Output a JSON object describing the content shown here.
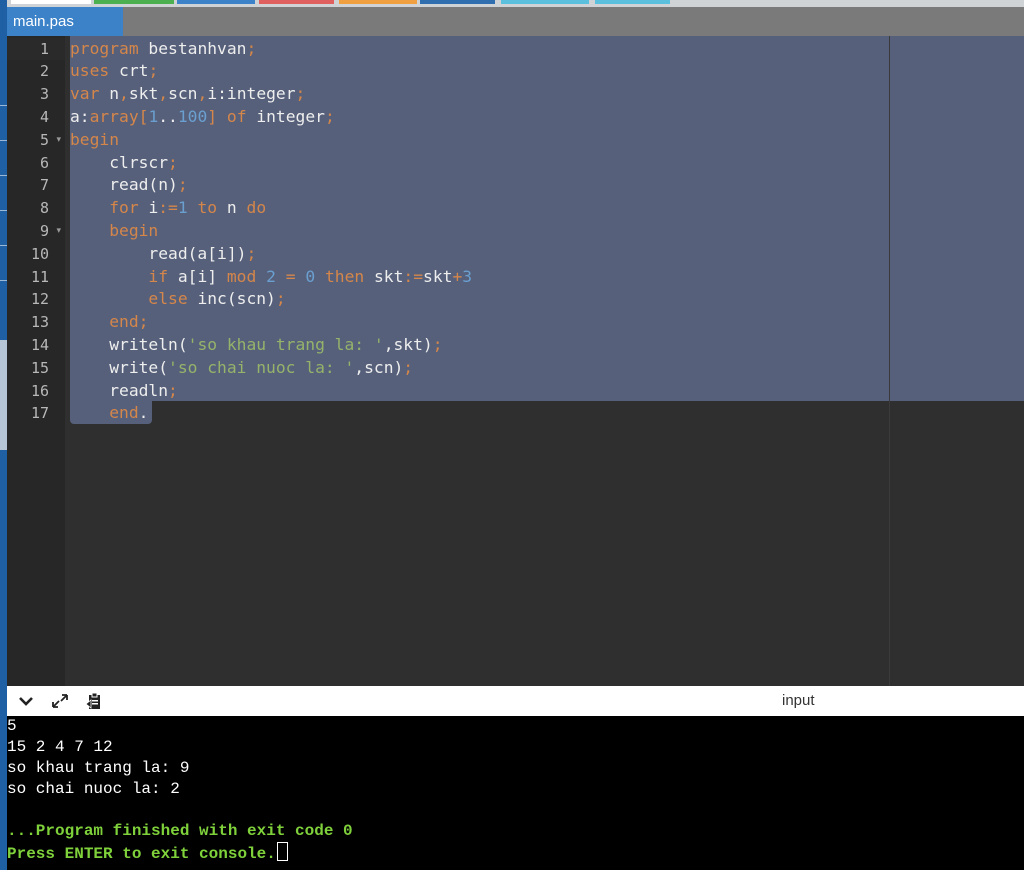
{
  "colors": {
    "tab_active": "#3c82c8",
    "keyword": "#d5864a",
    "number": "#6a9fd0",
    "string": "#95b36a",
    "selection": "#56607a",
    "console_green": "#7fd13b"
  },
  "tab": {
    "label": "main.pas"
  },
  "editor": {
    "line_numbers": [
      "1",
      "2",
      "3",
      "4",
      "5",
      "6",
      "7",
      "8",
      "9",
      "10",
      "11",
      "12",
      "13",
      "14",
      "15",
      "16",
      "17"
    ],
    "lines": [
      [
        [
          "kw",
          "program"
        ],
        [
          "pl",
          " bestanhvan"
        ],
        [
          "op",
          ";"
        ]
      ],
      [
        [
          "kw",
          "uses"
        ],
        [
          "pl",
          " crt"
        ],
        [
          "op",
          ";"
        ]
      ],
      [
        [
          "kw",
          "var"
        ],
        [
          "pl",
          " n"
        ],
        [
          "op",
          ","
        ],
        [
          "pl",
          "skt"
        ],
        [
          "op",
          ","
        ],
        [
          "pl",
          "scn"
        ],
        [
          "op",
          ","
        ],
        [
          "pl",
          "i:integer"
        ],
        [
          "op",
          ";"
        ]
      ],
      [
        [
          "pl",
          "a:"
        ],
        [
          "kw",
          "array"
        ],
        [
          "op",
          "["
        ],
        [
          "num",
          "1"
        ],
        [
          "pl",
          ".."
        ],
        [
          "num",
          "100"
        ],
        [
          "op",
          "]"
        ],
        [
          "pl",
          " "
        ],
        [
          "kw",
          "of"
        ],
        [
          "pl",
          " integer"
        ],
        [
          "op",
          ";"
        ]
      ],
      [
        [
          "kw",
          "begin"
        ]
      ],
      [
        [
          "pl",
          "    clrscr"
        ],
        [
          "op",
          ";"
        ]
      ],
      [
        [
          "pl",
          "    read(n)"
        ],
        [
          "op",
          ";"
        ]
      ],
      [
        [
          "pl",
          "    "
        ],
        [
          "kw",
          "for"
        ],
        [
          "pl",
          " i"
        ],
        [
          "op",
          ":="
        ],
        [
          "num",
          "1"
        ],
        [
          "pl",
          " "
        ],
        [
          "kw",
          "to"
        ],
        [
          "pl",
          " n "
        ],
        [
          "kw",
          "do"
        ]
      ],
      [
        [
          "pl",
          "    "
        ],
        [
          "kw",
          "begin"
        ]
      ],
      [
        [
          "pl",
          "        read(a[i])"
        ],
        [
          "op",
          ";"
        ]
      ],
      [
        [
          "pl",
          "        "
        ],
        [
          "kw",
          "if"
        ],
        [
          "pl",
          " a[i] "
        ],
        [
          "kw",
          "mod"
        ],
        [
          "pl",
          " "
        ],
        [
          "num",
          "2"
        ],
        [
          "pl",
          " "
        ],
        [
          "op",
          "="
        ],
        [
          "pl",
          " "
        ],
        [
          "num",
          "0"
        ],
        [
          "pl",
          " "
        ],
        [
          "kw",
          "then"
        ],
        [
          "pl",
          " skt"
        ],
        [
          "op",
          ":="
        ],
        [
          "pl",
          "skt"
        ],
        [
          "op",
          "+"
        ],
        [
          "num",
          "3"
        ]
      ],
      [
        [
          "pl",
          "        "
        ],
        [
          "kw",
          "else"
        ],
        [
          "pl",
          " inc(scn)"
        ],
        [
          "op",
          ";"
        ]
      ],
      [
        [
          "pl",
          "    "
        ],
        [
          "kw",
          "end"
        ],
        [
          "op",
          ";"
        ]
      ],
      [
        [
          "pl",
          "    writeln("
        ],
        [
          "str",
          "'so khau trang la: '"
        ],
        [
          "pl",
          ",skt)"
        ],
        [
          "op",
          ";"
        ]
      ],
      [
        [
          "pl",
          "    write("
        ],
        [
          "str",
          "'so chai nuoc la: '"
        ],
        [
          "pl",
          ",scn)"
        ],
        [
          "op",
          ";"
        ]
      ],
      [
        [
          "pl",
          "    readln"
        ],
        [
          "op",
          ";"
        ]
      ],
      [
        [
          "pl",
          "    "
        ],
        [
          "kw",
          "end"
        ],
        [
          "pl",
          "."
        ]
      ]
    ]
  },
  "console_header": {
    "input_label": "input"
  },
  "console": {
    "lines": [
      "5",
      "15 2 4 7 12",
      "so khau trang la: 9",
      "so chai nuoc la: 2",
      "",
      "...Program finished with exit code 0",
      "Press ENTER to exit console."
    ]
  }
}
